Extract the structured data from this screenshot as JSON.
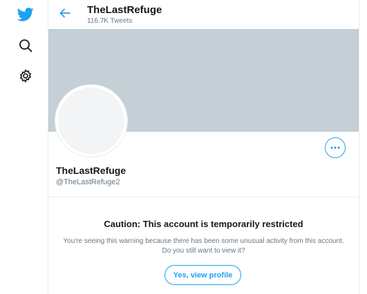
{
  "sidebar": {
    "icons": [
      "twitter-logo-icon",
      "search-icon",
      "gear-icon"
    ]
  },
  "header": {
    "name": "TheLastRefuge",
    "tweet_count": "116.7K Tweets"
  },
  "profile": {
    "name": "TheLastRefuge",
    "handle": "@TheLastRefuge2"
  },
  "warning": {
    "title": "Caution: This account is temporarily restricted",
    "text": "You're seeing this warning because there has been some unusual activity from this account. Do you still want to view it?",
    "button_label": "Yes, view profile"
  },
  "colors": {
    "accent": "#1da1f2",
    "banner": "#c4cfd6",
    "muted_text": "#657786"
  }
}
